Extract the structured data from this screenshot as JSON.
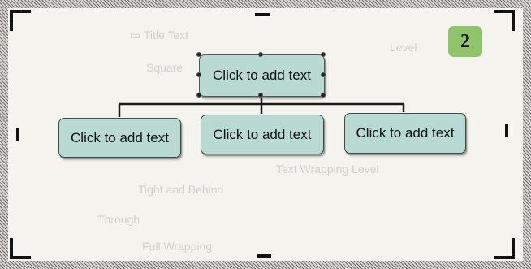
{
  "step_badge": "2",
  "org_chart": {
    "top": {
      "label": "Click to add text"
    },
    "children": [
      {
        "label": "Click to add text"
      },
      {
        "label": "Click to add text"
      },
      {
        "label": "Click to add text"
      }
    ]
  },
  "colors": {
    "box_fill": "#b9dad3",
    "badge_fill": "#8fc46a",
    "connector": "#1a1a1a"
  }
}
